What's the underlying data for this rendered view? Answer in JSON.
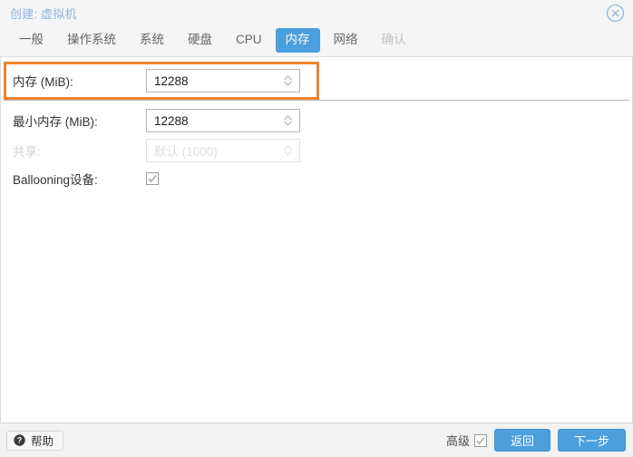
{
  "window": {
    "title": "创建: 虚拟机",
    "close_icon": "close-circle-icon"
  },
  "tabs": [
    {
      "label": "一般",
      "state": "normal"
    },
    {
      "label": "操作系统",
      "state": "normal"
    },
    {
      "label": "系统",
      "state": "normal"
    },
    {
      "label": "硬盘",
      "state": "normal"
    },
    {
      "label": "CPU",
      "state": "normal"
    },
    {
      "label": "内存",
      "state": "active"
    },
    {
      "label": "网络",
      "state": "normal"
    },
    {
      "label": "确认",
      "state": "disabled"
    }
  ],
  "form": {
    "memory": {
      "label": "内存 (MiB):",
      "value": "12288",
      "highlighted": true
    },
    "min_memory": {
      "label": "最小内存 (MiB):",
      "value": "12288"
    },
    "shares": {
      "label": "共享:",
      "placeholder": "默认 (1000)",
      "disabled": true
    },
    "ballooning": {
      "label": "Ballooning设备:",
      "checked": true
    }
  },
  "footer": {
    "help_label": "帮助",
    "help_icon": "question-circle-icon",
    "advanced_label": "高级",
    "advanced_checked": true,
    "back_label": "返回",
    "next_label": "下一步"
  },
  "colors": {
    "accent_blue": "#4a9fdc",
    "highlight_orange": "#ef8230",
    "title_text": "#8db3e2",
    "titlebar_bg": "#f5f5f5",
    "footer_bg": "#f2f2f2"
  }
}
